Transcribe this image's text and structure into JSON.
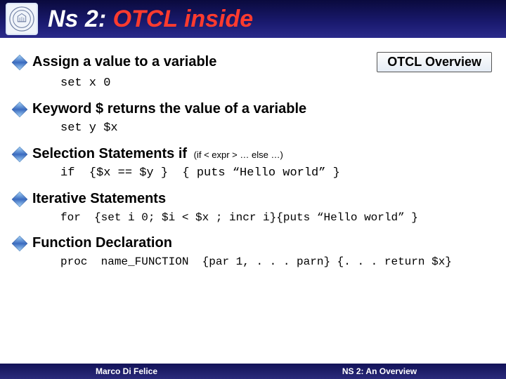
{
  "title_part1": "Ns 2: ",
  "title_part2": "OTCL inside",
  "badge": "OTCL Overview",
  "items": [
    {
      "heading": "Assign a value to a variable",
      "note": "",
      "code": "set x 0"
    },
    {
      "heading": "Keyword $ returns the value of a variable",
      "note": "",
      "code": "set y $x"
    },
    {
      "heading": "Selection Statements if",
      "note": "(if < expr > … else …)",
      "code": "if  {$x == $y }  { puts “Hello world” }"
    },
    {
      "heading": "Iterative Statements",
      "note": "",
      "code": "for  {set i 0; $i < $x ; incr i}{puts “Hello world” }"
    },
    {
      "heading": "Function Declaration",
      "note": "",
      "code": "proc  name_FUNCTION  {par 1, . . . parn} {. . . return $x}"
    }
  ],
  "footer_left": "Marco Di Felice",
  "footer_right": "NS 2: An Overview"
}
